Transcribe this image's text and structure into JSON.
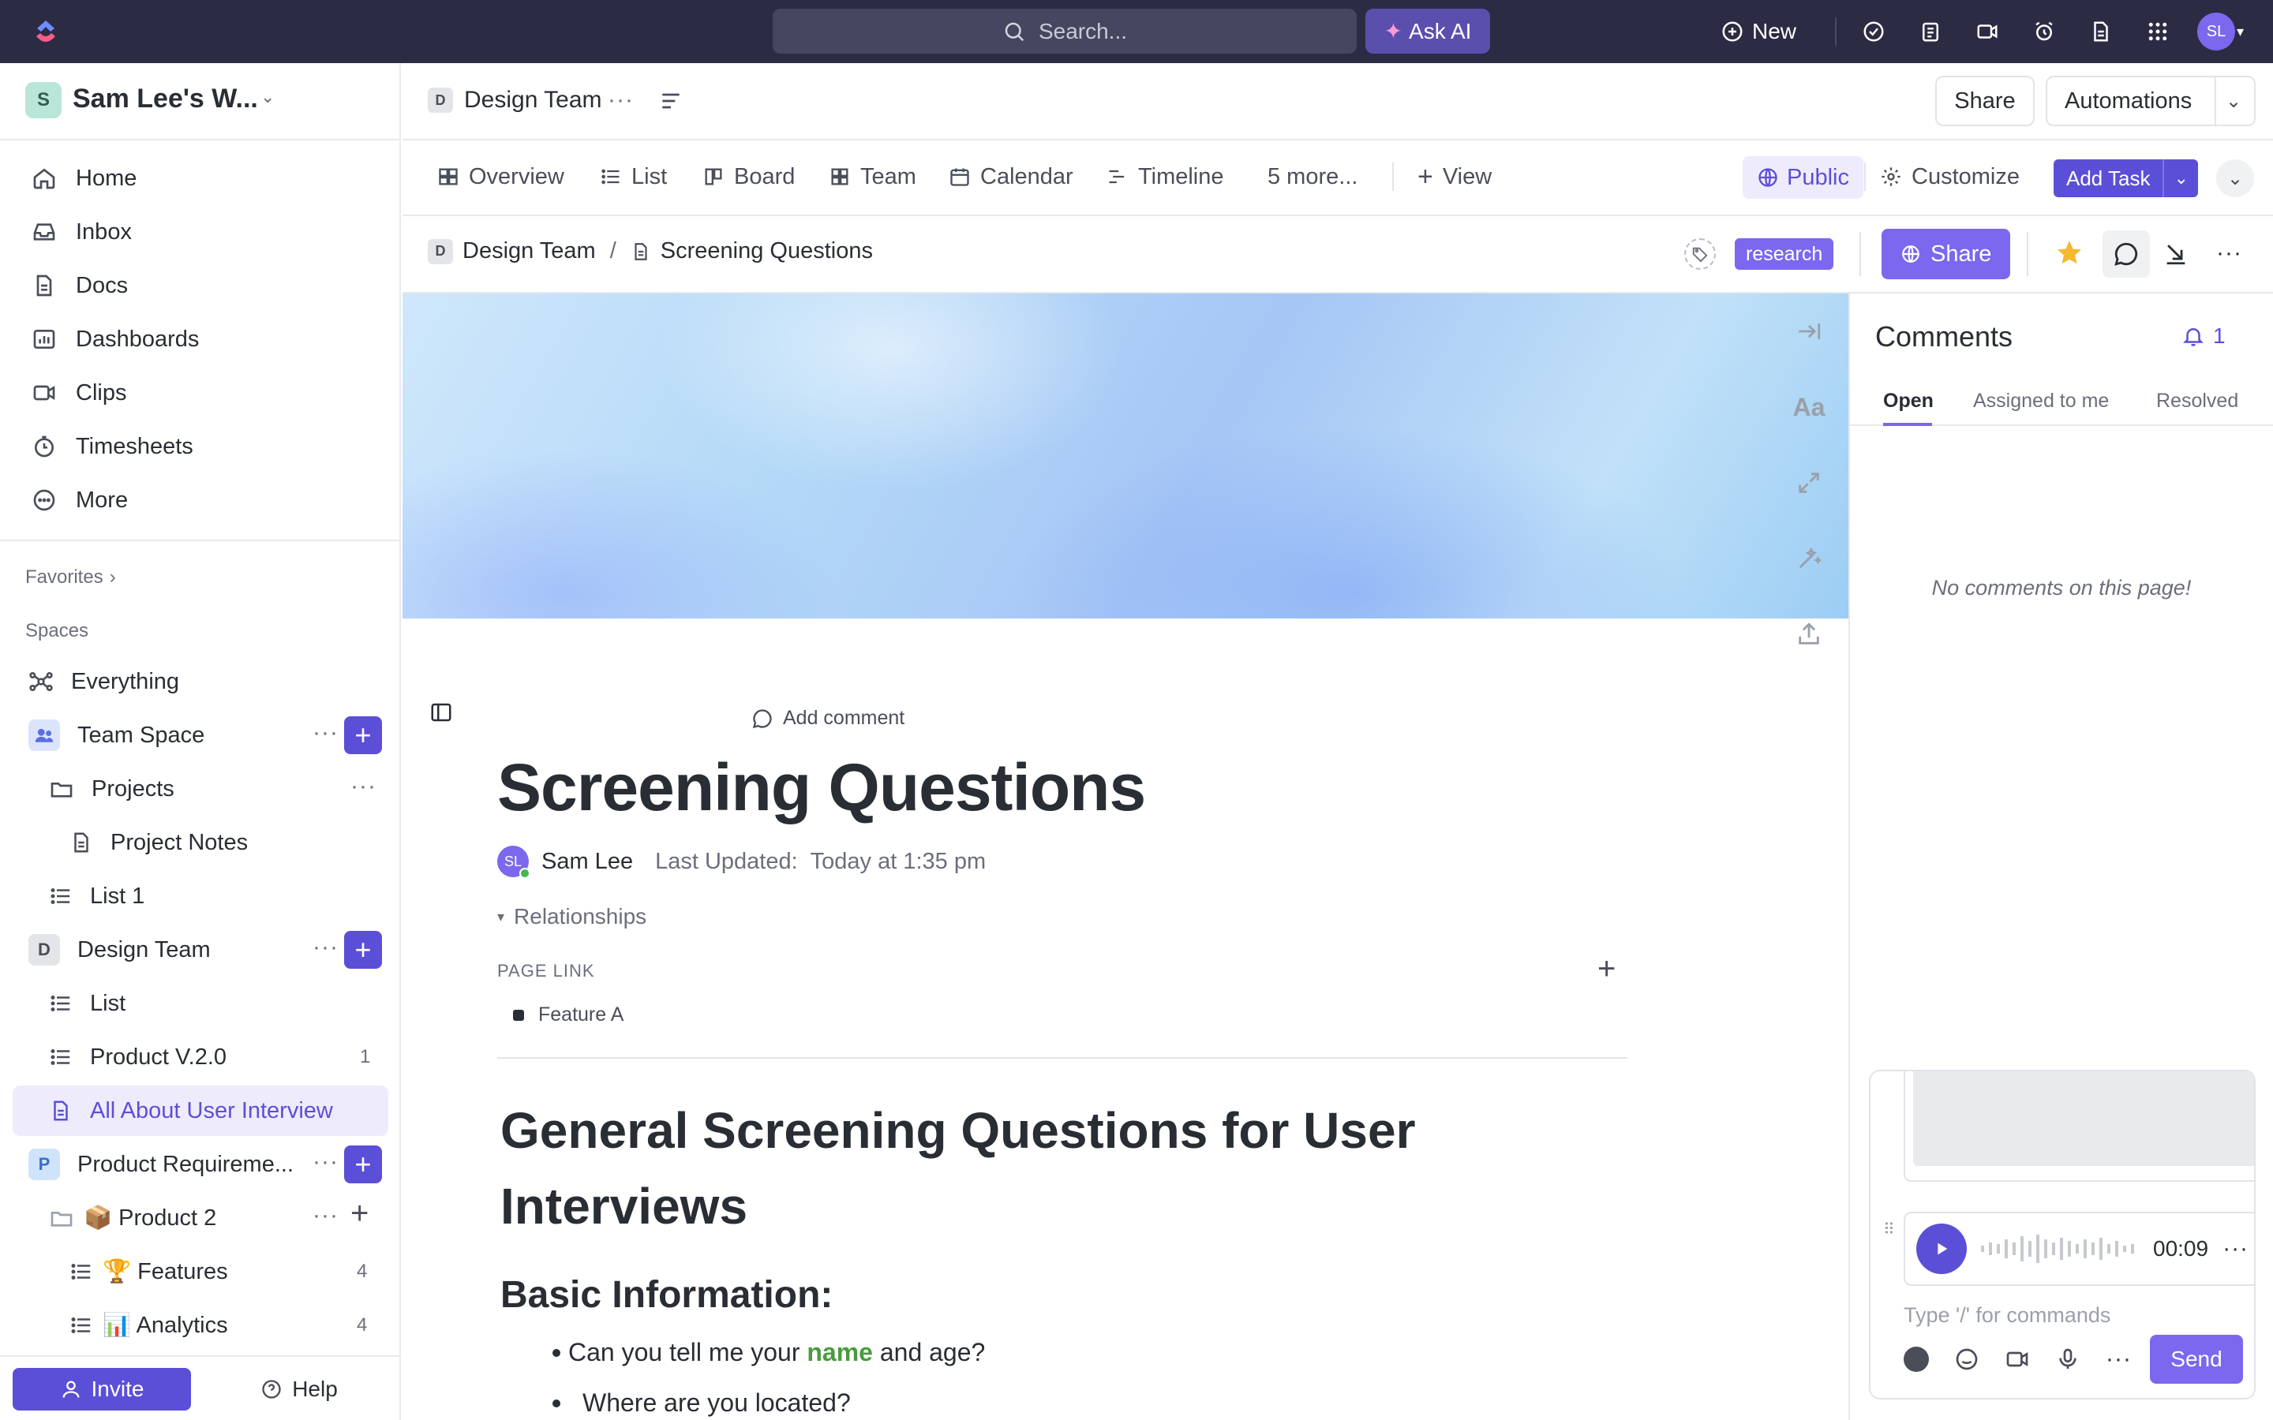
{
  "topbar": {
    "search_placeholder": "Search...",
    "ask_ai": "Ask AI",
    "new_label": "New",
    "avatar_initials": "SL"
  },
  "workspace": {
    "badge": "S",
    "name": "Sam Lee's W..."
  },
  "nav": [
    {
      "label": "Home",
      "icon": "home-icon"
    },
    {
      "label": "Inbox",
      "icon": "inbox-icon"
    },
    {
      "label": "Docs",
      "icon": "docs-icon"
    },
    {
      "label": "Dashboards",
      "icon": "dashboards-icon"
    },
    {
      "label": "Clips",
      "icon": "clips-icon"
    },
    {
      "label": "Timesheets",
      "icon": "timesheets-icon"
    },
    {
      "label": "More",
      "icon": "more-icon"
    }
  ],
  "favorites_label": "Favorites",
  "spaces_label": "Spaces",
  "tree": {
    "everything": "Everything",
    "team_space": "Team Space",
    "projects": "Projects",
    "project_notes": "Project Notes",
    "list1": "List 1",
    "design_team_badge": "D",
    "design_team": "Design Team",
    "list": "List",
    "product_v2": "Product V.2.0",
    "product_v2_count": "1",
    "all_about": "All About User Interview",
    "prodreq_badge": "P",
    "prodreq": "Product Requireme...",
    "product2": "📦 Product 2",
    "features": "🏆 Features",
    "features_count": "4",
    "analytics": "📊 Analytics",
    "analytics_count": "4"
  },
  "footer": {
    "invite": "Invite",
    "help": "Help"
  },
  "header": {
    "space_badge": "D",
    "space_name": "Design Team",
    "share": "Share",
    "automations": "Automations"
  },
  "views": {
    "tabs": [
      "Overview",
      "List",
      "Board",
      "Team",
      "Calendar",
      "Timeline"
    ],
    "more": "5 more...",
    "add_view": "View",
    "public": "Public",
    "customize": "Customize",
    "add_task": "Add Task"
  },
  "breadcrumb": {
    "space_badge": "D",
    "space": "Design Team",
    "separator": "/",
    "page": "Screening Questions",
    "tag": "research",
    "share": "Share"
  },
  "doc": {
    "add_comment": "Add comment",
    "title": "Screening Questions",
    "author_initials": "SL",
    "author": "Sam Lee",
    "updated_label": "Last Updated:",
    "updated_value": "Today at 1:35 pm",
    "relationships": "Relationships",
    "page_link_label": "PAGE LINK",
    "page_link_item": "Feature A",
    "h1_line1": "General Screening Questions for User",
    "h1_line2": "Interviews",
    "h2": "Basic Information:",
    "bullet1_pre": "Can you tell me your ",
    "bullet1_highlight": "name",
    "bullet1_post": " and age?",
    "bullet2": "Where are you located?",
    "highlight_color": "#4a9a3e"
  },
  "comments": {
    "title": "Comments",
    "notif_count": "1",
    "tabs": [
      "Open",
      "Assigned to me",
      "Resolved"
    ],
    "empty": "No comments on this page!",
    "audio_time": "00:09",
    "input_placeholder": "Type '/' for commands",
    "send": "Send"
  },
  "colors": {
    "accent": "#7b68ee",
    "accent_dark": "#5b4fd8",
    "topbar": "#2b2c44"
  }
}
